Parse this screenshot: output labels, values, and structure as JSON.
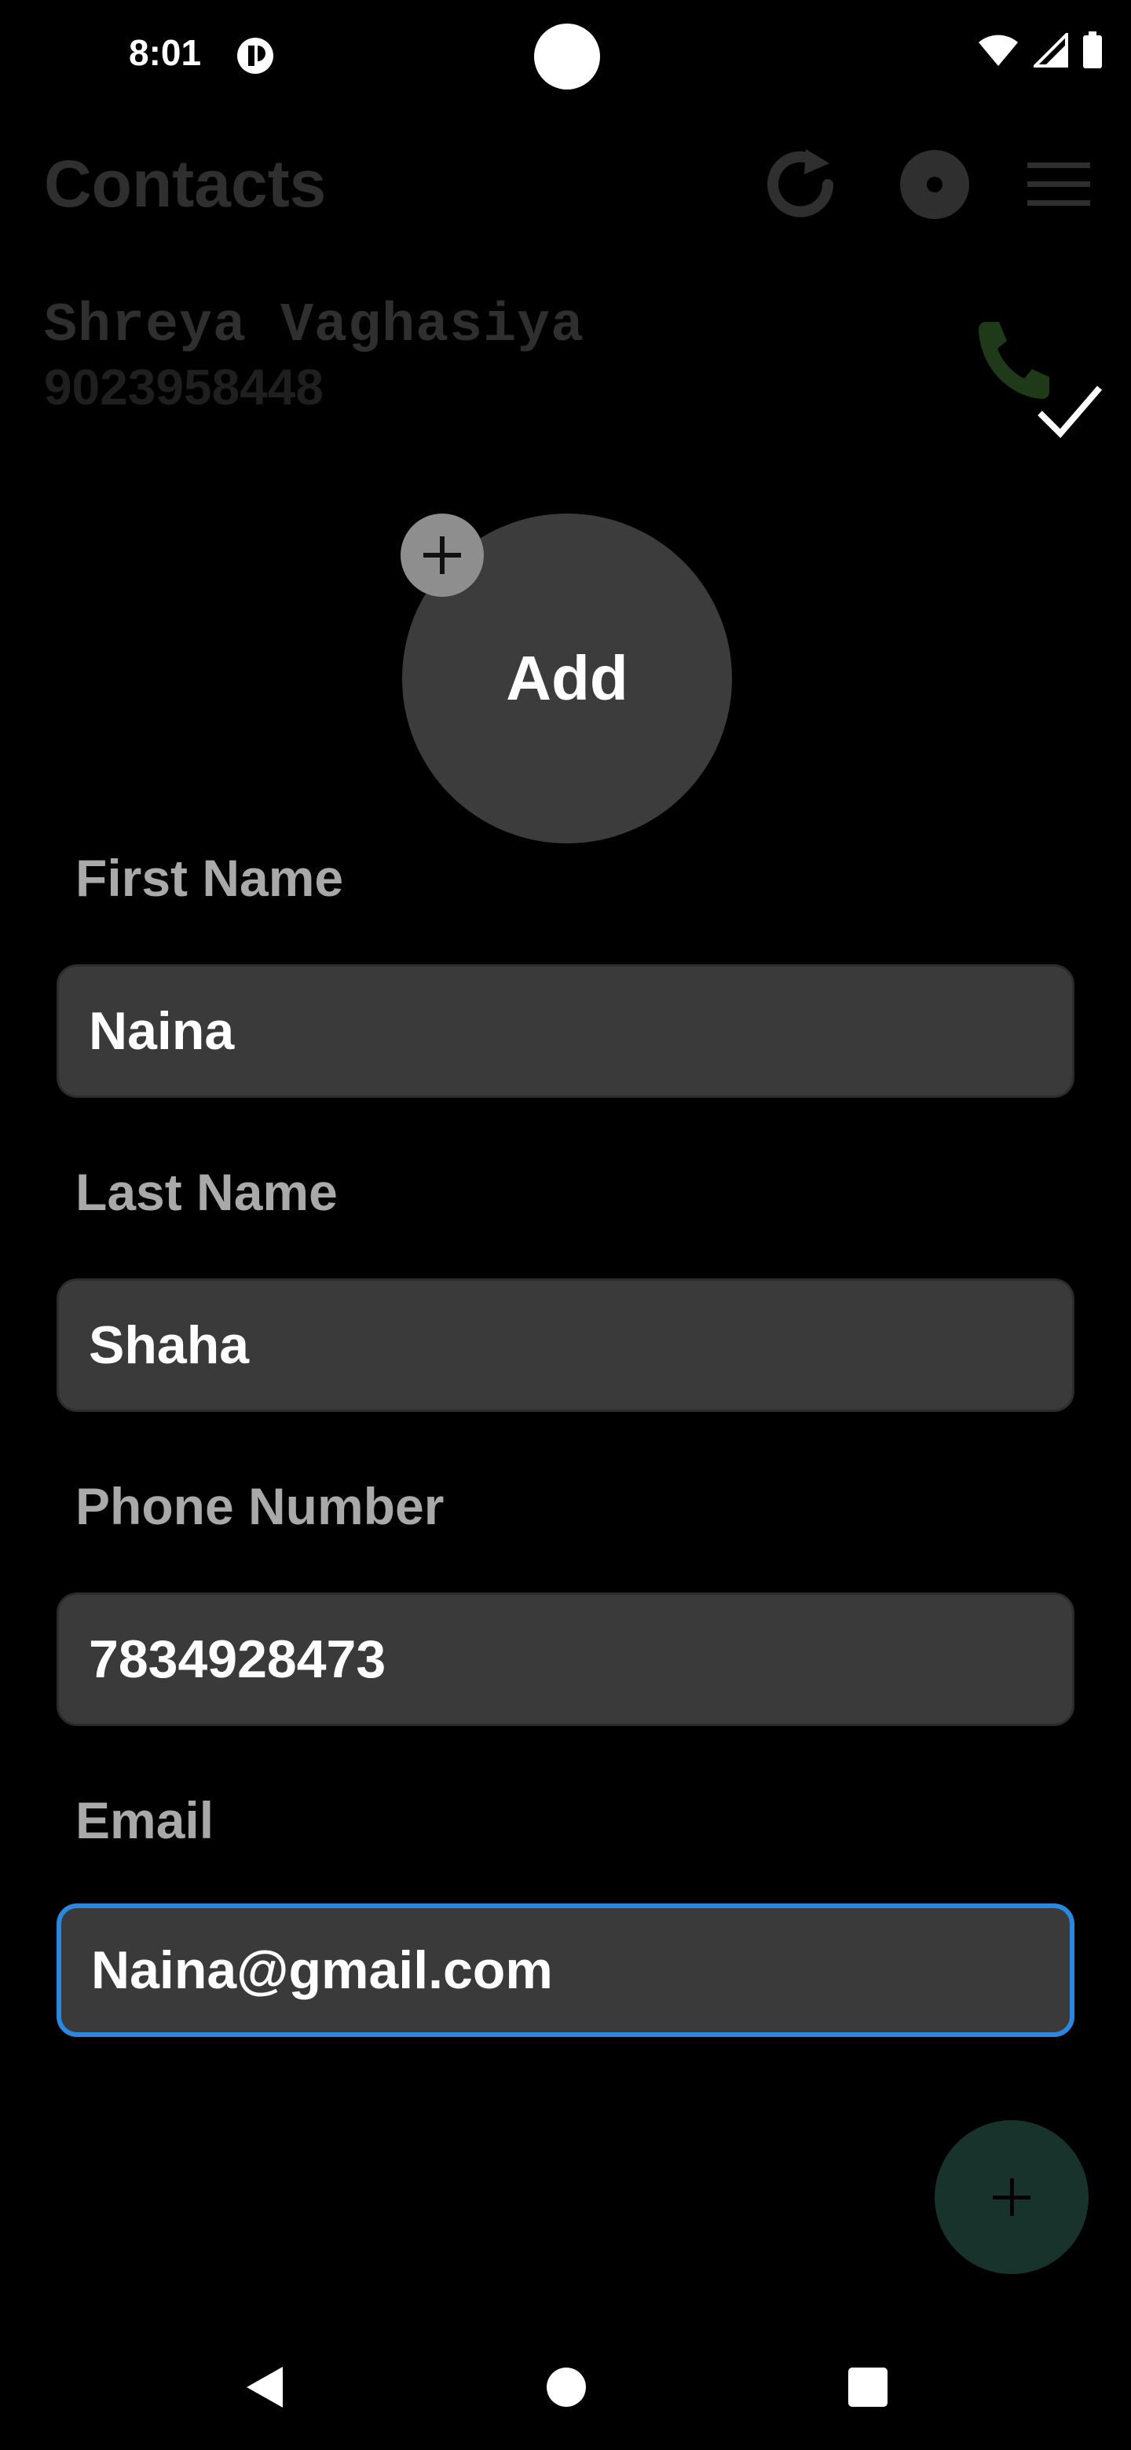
{
  "status_bar": {
    "time": "8:01"
  },
  "header": {
    "title": "Contacts"
  },
  "background_contact": {
    "name": "Shreya Vaghasiya",
    "phone": "9023958448"
  },
  "avatar": {
    "label": "Add"
  },
  "form": {
    "first_name": {
      "label": "First Name",
      "value": "Naina"
    },
    "last_name": {
      "label": "Last Name",
      "value": "Shaha"
    },
    "phone": {
      "label": "Phone Number",
      "value": "7834928473"
    },
    "email": {
      "label": "Email",
      "value": "Naina@gmail.com"
    }
  },
  "colors": {
    "focus_border": "#2b88e0",
    "fab": "#17332c",
    "field_bg": "#3a3a3a"
  },
  "icons": [
    "refresh-icon",
    "record-icon",
    "menu-icon",
    "phone-icon",
    "check-icon",
    "plus-icon",
    "wifi-icon",
    "signal-icon",
    "battery-icon"
  ]
}
